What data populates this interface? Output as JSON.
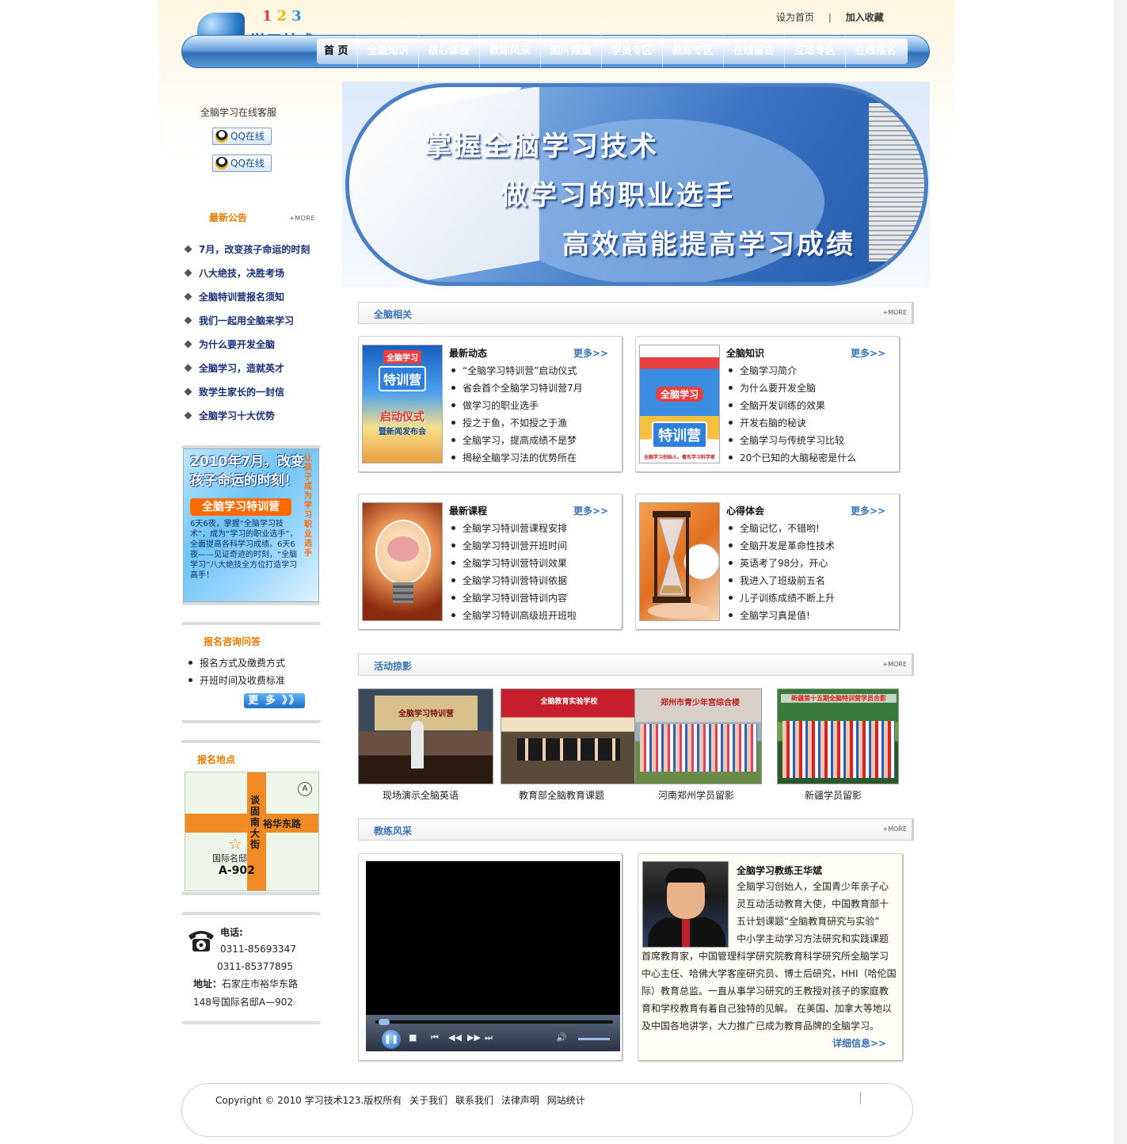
{
  "header": {
    "logo_numbers": [
      "1",
      "2",
      "3"
    ],
    "logo_text": "学习技术",
    "set_home": "设为首页",
    "separator": "|",
    "add_favorite": "加入收藏"
  },
  "nav": {
    "items": [
      "首 页",
      "全脑知识",
      "核心课程",
      "教练风采",
      "图片频道",
      "学员专区",
      "教练专区",
      "在线留言",
      "互动专区",
      "在线报名"
    ]
  },
  "sidebar": {
    "service_title": "全脑学习在线客服",
    "qq_buttons": [
      "QQ在线",
      "QQ在线"
    ],
    "notice_title": "最新公告",
    "notice_more": "+MORE",
    "notices": [
      "7月，改变孩子命运的时刻",
      "八大绝技，决胜考场",
      "全脑特训营报名须知",
      "我们一起用全脑来学习",
      "为什么要开发全脑",
      "全脑学习，造就英才",
      "致学生家长的一封信",
      "全脑学习十大优势"
    ],
    "promo": {
      "headline": "2010年7月，改变孩子命运的时刻！",
      "banner": "全脑学习特训营",
      "body": "6天6夜，掌握“全脑学习技术”，成为“学习的职业选手”，全面提高各科学习成绩。6天6夜——见证奇迹的时刻，“全脑学习”八大绝技全方位打造学习高手！",
      "vertical": "让孩子成为学习职业选手"
    },
    "faq_title": "报名咨询问答",
    "faq_items": [
      "报名方式及缴费方式",
      "开班时间及收费标准"
    ],
    "faq_more": "更 多 》》",
    "location_title": "报名地点",
    "map": {
      "road_h": "裕华东路",
      "road_v": "谈固南大街",
      "place": "国际名邸",
      "room": "A-902",
      "north": "A"
    },
    "contact": {
      "phone_label": "电话:",
      "phone1": "0311-85693347",
      "phone2": "0311-85377895",
      "addr_label": "地址：",
      "addr_line1": "石家庄市裕华东路",
      "addr_line2": "148号国际名邸A—902"
    }
  },
  "banner": {
    "line1": "掌握全脑学习技术",
    "line2": "做学习的职业选手",
    "line3": "高效高能提高学习成绩"
  },
  "sections": {
    "related": {
      "title": "全脑相关",
      "more": "+MORE"
    },
    "photos": {
      "title": "活动掠影",
      "more": "+MORE"
    },
    "coaches": {
      "title": "教练风采",
      "more": "+MORE"
    }
  },
  "cards": [
    {
      "title": "最新动态",
      "more": "更多>>",
      "img_text": [
        "全脑学习",
        "特训营",
        "启动仪式",
        "暨新闻发布会"
      ],
      "items": [
        "“全脑学习特训营”启动仪式",
        "省会首个全脑学习特训营7月",
        "做学习的职业选手",
        "授之于鱼，不如授之于渔",
        "全脑学习，提高成绩不是梦",
        "揭秘全脑学习法的优势所在"
      ]
    },
    {
      "title": "全脑知识",
      "more": "更多>>",
      "img_text": [
        "全脑学习",
        "特训营",
        "全脑学习创始人、著名学习科学家"
      ],
      "items": [
        "全脑学习简介",
        "为什么要开发全脑",
        "全脑开发训练的效果",
        "开发右脑的秘诀",
        "全脑学习与传统学习比较",
        "20个已知的大脑秘密是什么"
      ]
    },
    {
      "title": "最新课程",
      "more": "更多>>",
      "img_text": [],
      "items": [
        "全脑学习特训营课程安排",
        "全脑学习特训营开班时间",
        "全脑学习特训营特训效果",
        "全脑学习特训营特训依据",
        "全脑学习特训营特训内容",
        "全脑学习特训高级班开班啦"
      ]
    },
    {
      "title": "心得体会",
      "more": "更多>>",
      "img_text": [],
      "items": [
        "全脑记忆，不错哟!",
        "全脑开发是革命性技术",
        "英语考了98分，开心",
        "我进入了班级前五名",
        "儿子训练成绩不断上升",
        "全脑学习真是值!"
      ]
    }
  ],
  "photos": [
    {
      "caption": "现场演示全脑英语",
      "sign": "全脑学习特训营"
    },
    {
      "caption": "教育部全脑教育课题",
      "sign": "全脑教育实验学校"
    },
    {
      "caption": "河南郑州学员留影",
      "sign": "郑州市青少年宫综合楼"
    },
    {
      "caption": "新疆学员留影",
      "sign": "新疆第十五期全脑特训营学员合影"
    }
  ],
  "coach": {
    "name": "全脑学习教练王华斌",
    "bio_short": [
      "全脑学习创始人，全国青少年亲子心",
      "灵互动活动教育大使，中国教育部十",
      "五计划课题“全脑教育研究与实验”",
      "中小学主动学习方法研究和实践课题"
    ],
    "bio_long": [
      "首席教育家，中国管理科学研究院教育科学研究所全脑学习",
      "中心主任、哈佛大学客座研究员、博士后研究，HHI（哈伦国",
      "际）教育总监。一直从事学习研究的王教授对孩子的家庭教",
      "育和学校教育有着自己独特的见解。 在美国、加拿大等地以",
      "及中国各地讲学，大力推广已成为教育品牌的全脑学习。"
    ],
    "more": "详细信息>>"
  },
  "footer": {
    "copyright": "Copyright © 2010 学习技术123.版权所有",
    "links": [
      "关于我们",
      "联系我们",
      "法律声明",
      "网站统计"
    ]
  },
  "colors": {
    "accent": "#3a73b8",
    "orange": "#e87b00",
    "nav_blue": "#2f6fb6",
    "notice_text": "#1a2f78"
  }
}
